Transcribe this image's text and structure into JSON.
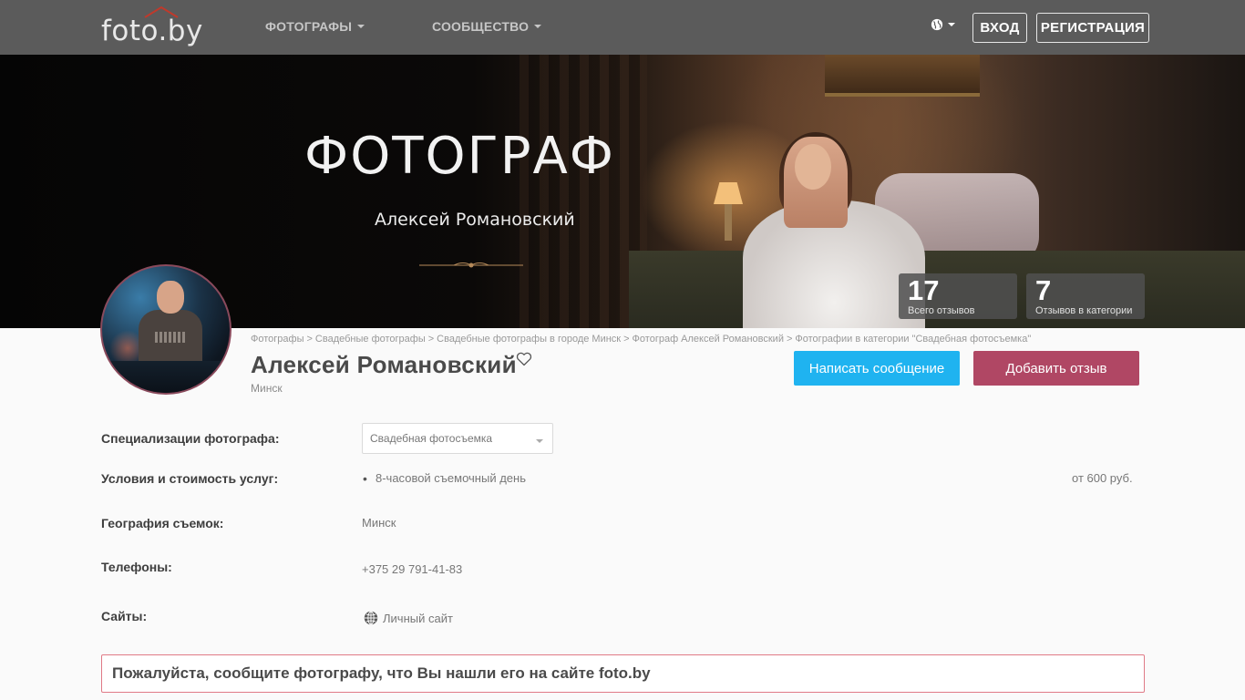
{
  "header": {
    "logo_text": "foto.by",
    "nav": [
      {
        "label": "ФОТОГРАФЫ"
      },
      {
        "label": "СООБЩЕСТВО"
      }
    ],
    "language_icon": "globe-icon",
    "login_label": "ВХОД",
    "register_label": "РЕГИСТРАЦИЯ"
  },
  "hero": {
    "title": "ФОТОГРАФ",
    "subtitle": "Алексей Романовский"
  },
  "stats": [
    {
      "value": "17",
      "label": "Всего отзывов"
    },
    {
      "value": "7",
      "label": "Отзывов в категории"
    }
  ],
  "breadcrumb": [
    "Фотографы",
    "Свадебные фотографы",
    "Свадебные фотографы в городе Минск",
    "Фотограф Алексей Романовский",
    "Фотографии в категории \"Свадебная фотосъемка\""
  ],
  "breadcrumb_separator": ">",
  "profile": {
    "name": "Алексей Романовский",
    "city": "Минск",
    "message_button": "Написать сообщение",
    "review_button": "Добавить отзыв"
  },
  "details": {
    "specialization_label": "Специализации фотографа:",
    "specialization_value": "Свадебная фотосъемка",
    "services_label": "Условия и стоимость услуг:",
    "service_item": "8-часовой съемочный день",
    "service_price": "от 600 руб.",
    "geography_label": "География съемок:",
    "geography_value": "Минск",
    "phones_label": "Телефоны:",
    "phone_value": "+375 29 791-41-83",
    "sites_label": "Сайты:",
    "site_value": "Личный сайт"
  },
  "notice": "Пожалуйста, сообщите фотографу, что Вы нашли его на сайте foto.by",
  "colors": {
    "topbar": "#5b5b5b",
    "message_button": "#1fb3f0",
    "review_button": "#b04764",
    "notice_border": "#e07a86"
  }
}
